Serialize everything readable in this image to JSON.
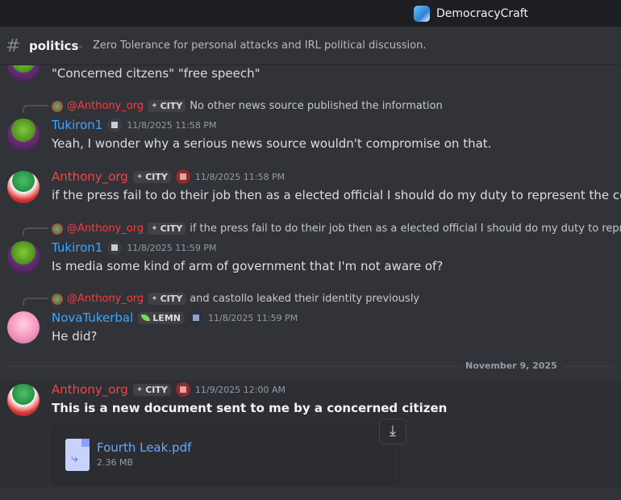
{
  "app": {
    "server_name": "DemocracyCraft"
  },
  "channel": {
    "name": "politics",
    "topic": "Zero Tolerance for personal attacks and IRL political discussion."
  },
  "messages": [
    {
      "text": "\"Concerned citzens\" \"free speech\""
    },
    {
      "reply": {
        "mention": "@Anthony_org",
        "tag": "CITY",
        "text": "No other news source published the information"
      },
      "author": "Tukiron1",
      "timestamp": "11/8/2025 11:58 PM",
      "text": "Yeah, I wonder why a serious news source wouldn't compromise on that."
    },
    {
      "author": "Anthony_org",
      "tag": "CITY",
      "timestamp": "11/8/2025 11:58 PM",
      "text": "if the press fail to do their job then as a elected official I should do my duty to represent the concerns of"
    },
    {
      "reply": {
        "mention": "@Anthony_org",
        "tag": "CITY",
        "text": "if the press fail to do their job then as a elected official I should do my duty to represent the"
      },
      "author": "Tukiron1",
      "timestamp": "11/8/2025 11:59 PM",
      "text": "Is media some kind of arm of government that I'm not aware of?"
    },
    {
      "reply": {
        "mention": "@Anthony_org",
        "tag": "CITY",
        "text": "and castollo leaked their identity previously"
      },
      "author": "NovaTukerbal",
      "tag": "LEMN",
      "timestamp": "11/8/2025 11:59 PM",
      "text": "He did?"
    },
    {
      "author": "Anthony_org",
      "tag": "CITY",
      "timestamp": "11/9/2025 12:00 AM",
      "text": "This is a new document sent to me by a concerned citizen",
      "attachment": {
        "name": "Fourth Leak.pdf",
        "size": "2.36 MB"
      }
    }
  ],
  "date_divider": "November 9, 2025",
  "colors": {
    "mention": "#f23f43",
    "tukiron": "#3ea6ff",
    "anthony": "#f04747",
    "link": "#6aa6ff"
  }
}
